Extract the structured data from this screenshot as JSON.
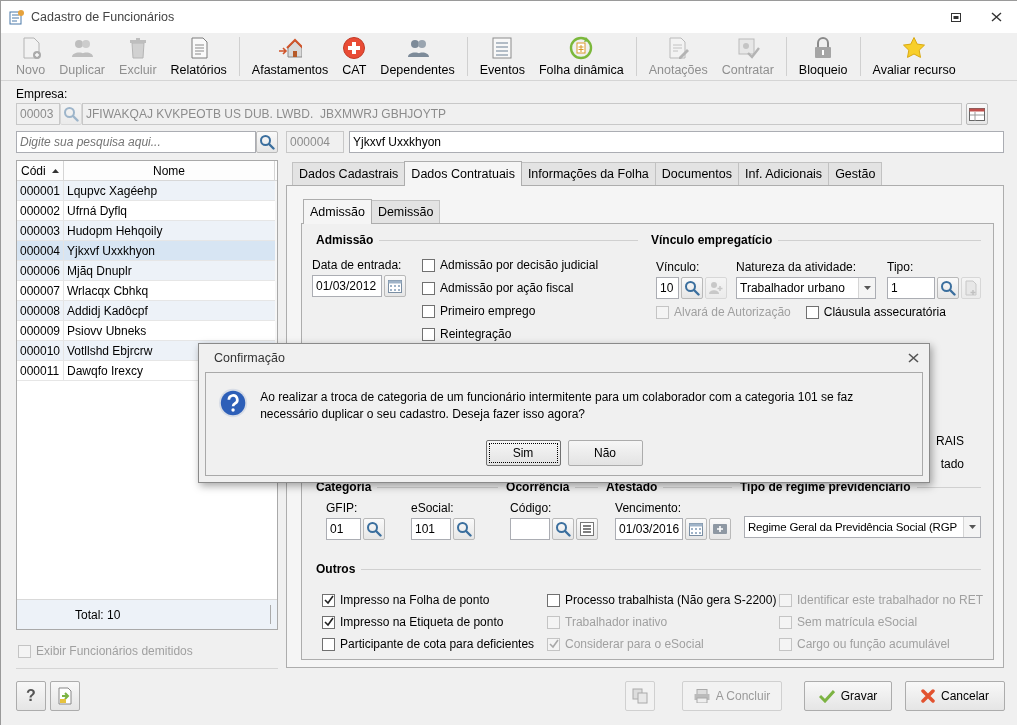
{
  "window": {
    "title": "Cadastro de Funcionários"
  },
  "toolbar": {
    "groups": [
      {
        "items": [
          {
            "label": "Novo",
            "disabled": true
          },
          {
            "label": "Duplicar",
            "disabled": true
          },
          {
            "label": "Excluir",
            "disabled": true
          },
          {
            "label": "Relatórios",
            "disabled": false
          }
        ]
      },
      {
        "items": [
          {
            "label": "Afastamentos",
            "disabled": false
          },
          {
            "label": "CAT",
            "disabled": false
          },
          {
            "label": "Dependentes",
            "disabled": false
          }
        ]
      },
      {
        "items": [
          {
            "label": "Eventos",
            "disabled": false
          },
          {
            "label": "Folha dinâmica",
            "disabled": false
          }
        ]
      },
      {
        "items": [
          {
            "label": "Anotações",
            "disabled": true
          },
          {
            "label": "Contratar",
            "disabled": true
          }
        ]
      },
      {
        "items": [
          {
            "label": "Bloqueio",
            "disabled": false
          }
        ]
      },
      {
        "items": [
          {
            "label": "Avaliar recurso",
            "disabled": false
          }
        ]
      }
    ]
  },
  "empresa": {
    "label": "Empresa:",
    "code": "00003",
    "name": "JFIWAKQAJ KVKPEOTB US DUB. LWBD.  JBXMWRJ GBHJOYTP"
  },
  "search": {
    "placeholder": "Digite sua pesquisa aqui..."
  },
  "current": {
    "code": "000004",
    "name": "Yjkxvf Uxxkhyon"
  },
  "employees": {
    "columns": [
      {
        "label": "Códi",
        "sorted": true
      },
      {
        "label": "Nome",
        "sorted": false
      }
    ],
    "rows": [
      {
        "code": "000001",
        "name": "Lqupvc Xagéehp",
        "selected": false
      },
      {
        "code": "000002",
        "name": "Ufrná Dyflq",
        "selected": false
      },
      {
        "code": "000003",
        "name": "Hudopm Hehqoily",
        "selected": false
      },
      {
        "code": "000004",
        "name": "Yjkxvf Uxxkhyon",
        "selected": true
      },
      {
        "code": "000006",
        "name": "Mjãq Dnuplr",
        "selected": false
      },
      {
        "code": "000007",
        "name": "Wrlacqx Cbhkq",
        "selected": false
      },
      {
        "code": "000008",
        "name": "Addidj Kadôcpf",
        "selected": false
      },
      {
        "code": "000009",
        "name": "Psiovv Ubneks",
        "selected": false
      },
      {
        "code": "000010",
        "name": "Votllshd Ebjrcrw",
        "selected": false
      },
      {
        "code": "000011",
        "name": "Dawqfo Irexcy",
        "selected": false
      }
    ],
    "total": "Total: 10"
  },
  "show_dismissed": {
    "label": "Exibir Funcionários demitidos",
    "checked": false,
    "disabled": true
  },
  "tabs": [
    {
      "label": "Dados Cadastrais",
      "selected": false
    },
    {
      "label": "Dados Contratuais",
      "selected": true
    },
    {
      "label": "Informações da Folha",
      "selected": false
    },
    {
      "label": "Documentos",
      "selected": false
    },
    {
      "label": "Inf. Adicionais",
      "selected": false
    },
    {
      "label": "Gestão",
      "selected": false
    }
  ],
  "subtabs": [
    {
      "label": "Admissão",
      "selected": true
    },
    {
      "label": "Demissão",
      "selected": false
    }
  ],
  "admissao": {
    "title": "Admissão",
    "date_label": "Data de entrada:",
    "date": "01/03/2012",
    "checks": [
      {
        "label": "Admissão por decisão judicial",
        "checked": false
      },
      {
        "label": "Admissão por ação fiscal",
        "checked": false
      },
      {
        "label": "Primeiro emprego",
        "checked": false
      },
      {
        "label": "Reintegração",
        "checked": false
      }
    ]
  },
  "vinculo": {
    "title": "Vínculo empregatício",
    "vinculo_label": "Vínculo:",
    "vinculo": "10",
    "natureza_label": "Natureza da atividade:",
    "natureza": "Trabalhador urbano",
    "tipo_label": "Tipo:",
    "tipo": "1",
    "checks": [
      {
        "label": "Alvará de Autorização",
        "checked": false,
        "disabled": true
      },
      {
        "label": "Cláusula assecuratória",
        "checked": false,
        "disabled": false
      }
    ]
  },
  "covered": {
    "texts": [
      "RAIS",
      "tado"
    ]
  },
  "categoria": {
    "title": "Categoria",
    "gfip_label": "GFIP:",
    "gfip": "01",
    "esocial_label": "eSocial:",
    "esocial": "101"
  },
  "ocorrencia": {
    "title": "Ocorrência",
    "codigo_label": "Código:"
  },
  "atestado": {
    "title": "Atestado",
    "vencimento_label": "Vencimento:",
    "vencimento": "01/03/2016"
  },
  "regime": {
    "title": "Tipo de regime previdenciário",
    "value": "Regime Geral da Previdência Social (RGP"
  },
  "outros": {
    "title": "Outros",
    "checks": [
      {
        "label": "Impresso na Folha de ponto",
        "checked": true,
        "disabled": false
      },
      {
        "label": "Processo trabalhista (Não gera S-2200)",
        "checked": false,
        "disabled": false
      },
      {
        "label": "Identificar este trabalhador no RET",
        "checked": false,
        "disabled": true
      },
      {
        "label": "Impresso na Etiqueta de ponto",
        "checked": true,
        "disabled": false
      },
      {
        "label": "Trabalhador inativo",
        "checked": false,
        "disabled": true
      },
      {
        "label": "Sem matrícula eSocial",
        "checked": false,
        "disabled": true
      },
      {
        "label": "Participante de cota para deficientes",
        "checked": false,
        "disabled": false
      },
      {
        "label": "Considerar para o eSocial",
        "checked": true,
        "disabled": true
      },
      {
        "label": "Cargo ou função acumulável",
        "checked": false,
        "disabled": true
      }
    ]
  },
  "footer": {
    "help": "?",
    "buttons": [
      {
        "label": "A Concluir",
        "disabled": true
      },
      {
        "label": "Gravar",
        "disabled": false
      },
      {
        "label": "Cancelar",
        "disabled": false
      }
    ]
  },
  "dialog": {
    "title": "Confirmação",
    "message": "Ao realizar a troca de categoria de um funcionário intermitente para um colaborador com a categoria 101 se faz necessário duplicar o seu cadastro. Deseja fazer isso agora?",
    "buttons": [
      {
        "label": "Sim",
        "focused": true
      },
      {
        "label": "Não",
        "focused": false
      }
    ]
  }
}
